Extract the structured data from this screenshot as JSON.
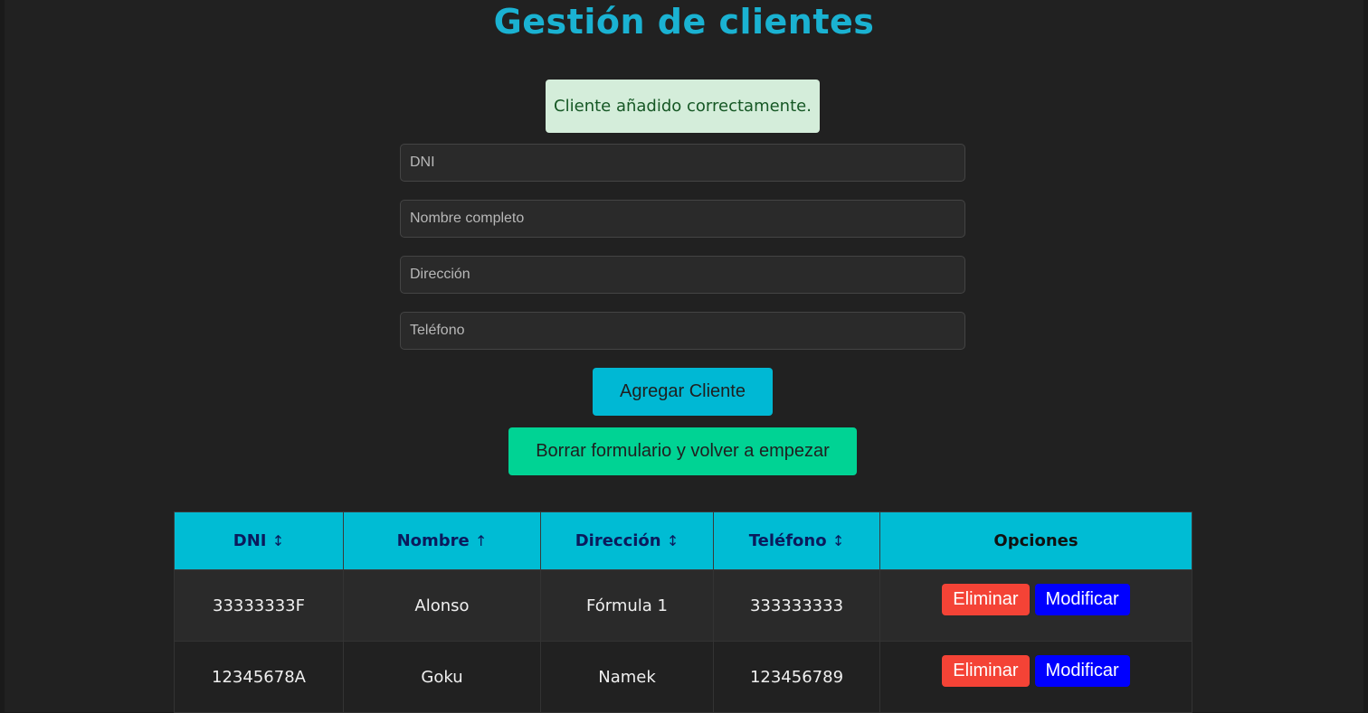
{
  "header": {
    "title": "Gestión de clientes"
  },
  "alert": {
    "message": "Cliente añadido correctamente."
  },
  "form": {
    "dni_placeholder": "DNI",
    "nombre_placeholder": "Nombre completo",
    "direccion_placeholder": "Dirección",
    "telefono_placeholder": "Teléfono",
    "add_label": "Agregar Cliente",
    "reset_label": "Borrar formulario y volver a empezar"
  },
  "table": {
    "columns": [
      {
        "label": "DNI",
        "sort": "↕"
      },
      {
        "label": "Nombre",
        "sort": "↑"
      },
      {
        "label": "Dirección",
        "sort": "↕"
      },
      {
        "label": "Teléfono",
        "sort": "↕"
      },
      {
        "label": "Opciones",
        "sort": ""
      }
    ],
    "rows": [
      {
        "dni": "33333333F",
        "nombre": "Alonso",
        "direccion": "Fórmula 1",
        "telefono": "333333333"
      },
      {
        "dni": "12345678A",
        "nombre": "Goku",
        "direccion": "Namek",
        "telefono": "123456789"
      }
    ],
    "delete_label": "Eliminar",
    "modify_label": "Modificar"
  },
  "colors": {
    "title": "#1ab2d2",
    "header_bg": "#00bcd4",
    "add_button": "#00b8d4",
    "reset_button": "#00d394",
    "delete_button": "#f44336",
    "modify_button": "#0000ff",
    "alert_bg": "#d4edda"
  }
}
